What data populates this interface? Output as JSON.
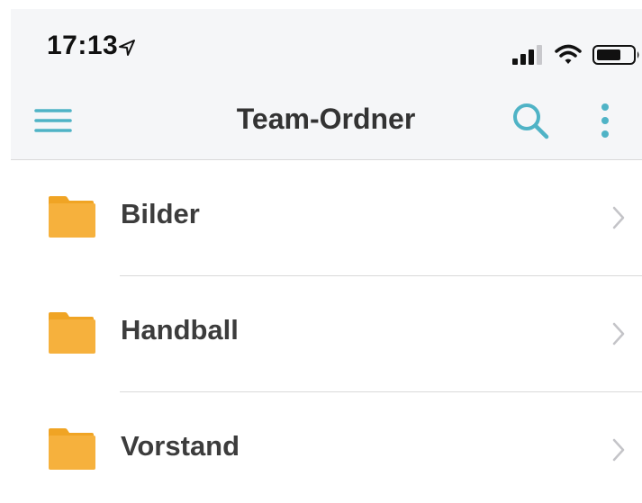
{
  "status_bar": {
    "time": "17:13",
    "icons": [
      "location-arrow-icon",
      "signal-icon",
      "wifi-icon",
      "battery-icon"
    ]
  },
  "nav": {
    "title": "Team-Ordner",
    "left_icon": "menu-icon",
    "right_icons": [
      "search-icon",
      "more-vertical-icon"
    ]
  },
  "folders": [
    {
      "label": "Bilder",
      "icon": "folder-icon"
    },
    {
      "label": "Handball",
      "icon": "folder-icon"
    },
    {
      "label": "Vorstand",
      "icon": "folder-icon"
    }
  ],
  "colors": {
    "accent": "#4fb3c6",
    "folder": "#f6b13d",
    "folder_tab": "#f0a424",
    "header_bg": "#f5f6f8",
    "chevron": "#c4c4c8"
  }
}
